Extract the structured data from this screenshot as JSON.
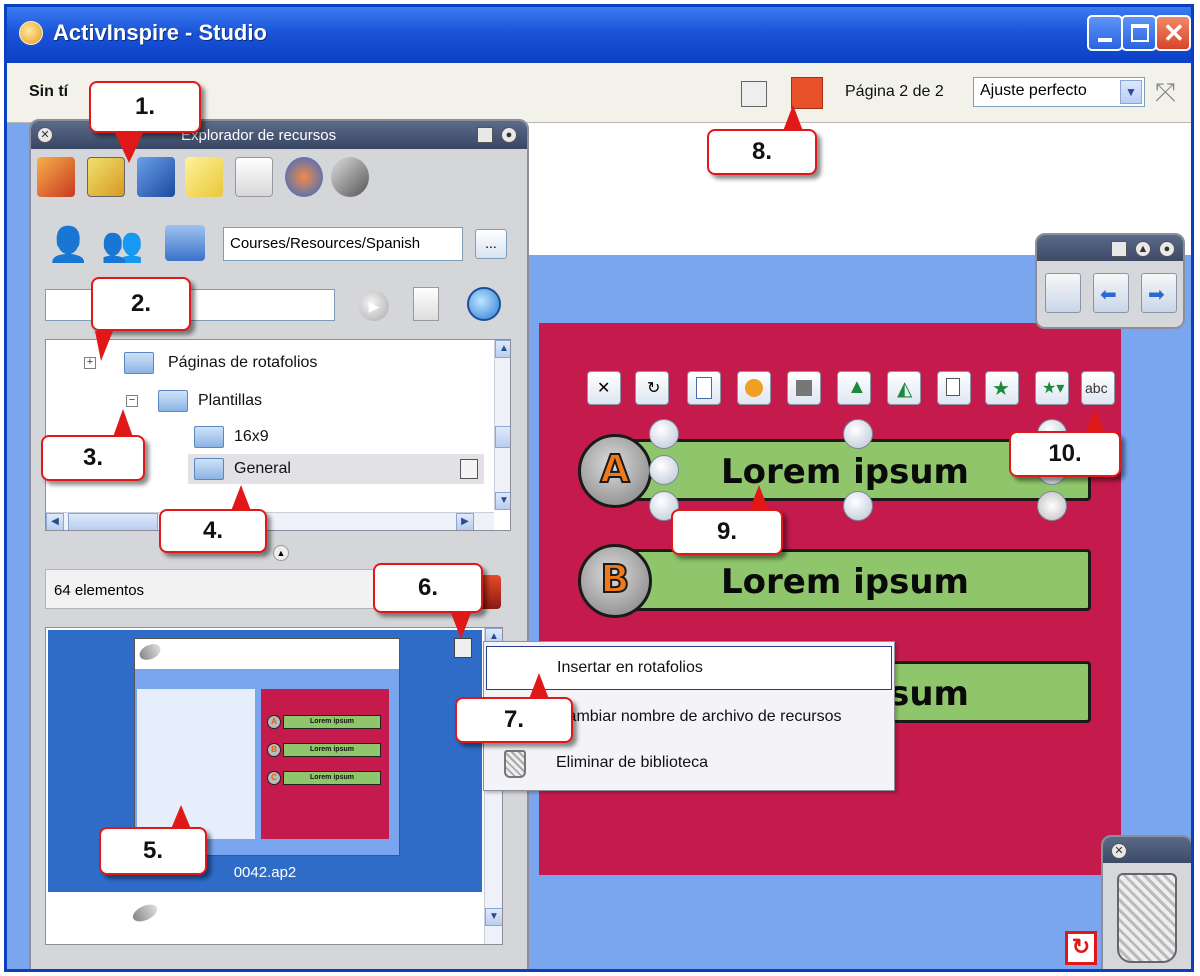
{
  "window": {
    "title": "ActivInspire - Studio",
    "controls": [
      "minimize-icon",
      "maximize-icon",
      "close-icon"
    ]
  },
  "toolbar": {
    "doc_title": "Sin tí",
    "page_indicator": "Página 2 de 2",
    "zoom_value": "Ajuste perfecto"
  },
  "resource_browser": {
    "title": "Explorador de recursos",
    "tabs": [
      "my-resources-icon",
      "shared-resources-icon",
      "pages-icon",
      "notes-icon",
      "properties-icon",
      "actions-icon",
      "voice-record-icon"
    ],
    "path": "Courses/Resources/Spanish",
    "path_more_label": "...",
    "tree": {
      "items": [
        {
          "label": "Páginas de rotafolios",
          "expander": "+"
        },
        {
          "label": "Plantillas",
          "expander": "−"
        },
        {
          "label": "16x9"
        },
        {
          "label": "General"
        }
      ]
    },
    "item_count": "64 elementos",
    "thumbnail": {
      "name": "0042.ap2",
      "mini_letters": [
        "A",
        "B",
        "C"
      ],
      "mini_text": "Lorem ipsum"
    }
  },
  "context_menu": {
    "items": [
      {
        "label": "Insertar en rotafolios"
      },
      {
        "label": "Cambiar nombre de archivo de recursos"
      },
      {
        "label": "Eliminar de biblioteca"
      }
    ]
  },
  "flipchart": {
    "answers": [
      {
        "letter": "A",
        "text": "Lorem ipsum"
      },
      {
        "letter": "B",
        "text": "Lorem ipsum"
      },
      {
        "letter": "C",
        "text": "Lorem ipsum"
      }
    ],
    "object_tools": [
      "resize-icon",
      "rotate-icon",
      "menu-icon",
      "fill-icon",
      "layer-icon",
      "flip-up-icon",
      "flip-side-icon",
      "duplicate-icon",
      "star-up-icon",
      "star-down-icon",
      "spellcheck-icon"
    ],
    "spellcheck_label": "abc"
  },
  "callouts": [
    "1.",
    "2.",
    "3.",
    "4.",
    "5.",
    "6.",
    "7.",
    "8.",
    "9.",
    "10."
  ],
  "colors": {
    "titlebar": "#1b54d8",
    "canvas_bg": "#7aa6f0",
    "page_bg": "#c41a4c",
    "answer_bg": "#8fc66b",
    "callout_border": "#e01818"
  }
}
